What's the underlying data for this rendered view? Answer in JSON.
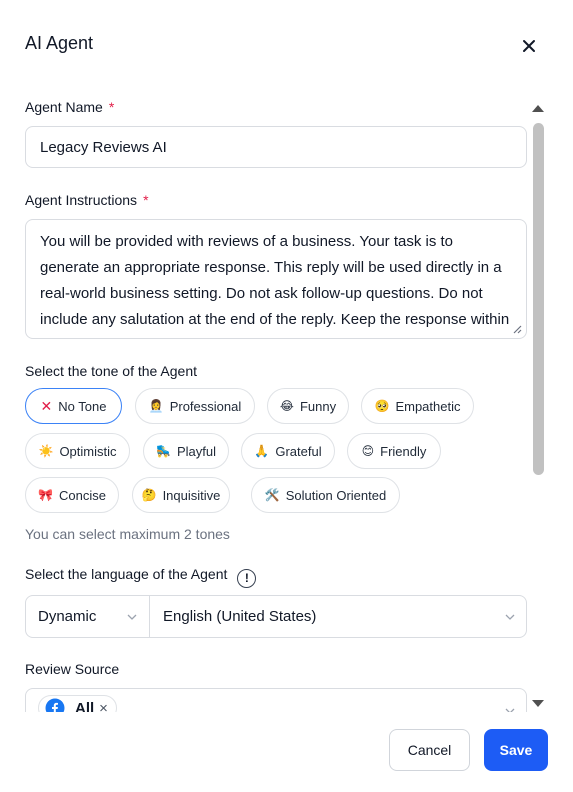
{
  "dialog": {
    "title": "AI Agent"
  },
  "agent_name": {
    "label": "Agent Name",
    "required_mark": "*",
    "value": "Legacy Reviews AI"
  },
  "agent_instructions": {
    "label": "Agent Instructions",
    "required_mark": "*",
    "value": "You will be provided with reviews of a business. Your task is to generate an appropriate response. This reply will be used directly in a real-world business setting. Do not ask follow-up questions. Do not include any salutation at the end of the reply. Keep the response within five sentences."
  },
  "tone": {
    "label": "Select the tone of the Agent",
    "options": [
      {
        "icon": "✕",
        "label": "No Tone",
        "selected": true
      },
      {
        "icon": "👩‍💼",
        "label": "Professional",
        "selected": false
      },
      {
        "icon": "😂",
        "label": "Funny",
        "selected": false
      },
      {
        "icon": "🥺",
        "label": "Empathetic",
        "selected": false
      },
      {
        "icon": "☀️",
        "label": "Optimistic",
        "selected": false
      },
      {
        "icon": "🛼",
        "label": "Playful",
        "selected": false
      },
      {
        "icon": "🙏",
        "label": "Grateful",
        "selected": false
      },
      {
        "icon": "😊",
        "label": "Friendly",
        "selected": false
      },
      {
        "icon": "🎀",
        "label": "Concise",
        "selected": false
      },
      {
        "icon": "🤔",
        "label": "Inquisitive",
        "selected": false
      },
      {
        "icon": "🛠️",
        "label": "Solution Oriented",
        "selected": false
      }
    ],
    "hint": "You can select maximum 2 tones"
  },
  "language": {
    "label": "Select the language of the Agent",
    "info_icon": "!",
    "mode_value": "Dynamic",
    "language_value": "English (United States)"
  },
  "review_source": {
    "label": "Review Source",
    "selected_chip": "All",
    "remove_glyph": "×"
  },
  "footer": {
    "cancel_label": "Cancel",
    "save_label": "Save"
  },
  "colors": {
    "primary": "#1d5cf5",
    "required": "#e11d48",
    "selected_border": "#3b82f6"
  }
}
